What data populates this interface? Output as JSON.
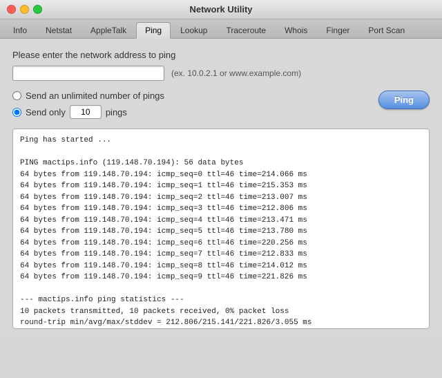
{
  "titlebar": {
    "title": "Network Utility"
  },
  "tabs": [
    {
      "label": "Info",
      "id": "info",
      "active": false
    },
    {
      "label": "Netstat",
      "id": "netstat",
      "active": false
    },
    {
      "label": "AppleTalk",
      "id": "appletalk",
      "active": false
    },
    {
      "label": "Ping",
      "id": "ping",
      "active": true
    },
    {
      "label": "Lookup",
      "id": "lookup",
      "active": false
    },
    {
      "label": "Traceroute",
      "id": "traceroute",
      "active": false
    },
    {
      "label": "Whois",
      "id": "whois",
      "active": false
    },
    {
      "label": "Finger",
      "id": "finger",
      "active": false
    },
    {
      "label": "Port Scan",
      "id": "portscan",
      "active": false
    }
  ],
  "ping": {
    "prompt": "Please enter the network address to ping",
    "address_placeholder": "",
    "address_hint": "(ex. 10.0.2.1 or www.example.com)",
    "radio_unlimited_label": "Send an unlimited number of pings",
    "radio_sendonly_label": "Send only",
    "pings_value": "10",
    "pings_suffix": "pings",
    "ping_button_label": "Ping",
    "output": "Ping has started ...\n\nPING mactips.info (119.148.70.194): 56 data bytes\n64 bytes from 119.148.70.194: icmp_seq=0 ttl=46 time=214.066 ms\n64 bytes from 119.148.70.194: icmp_seq=1 ttl=46 time=215.353 ms\n64 bytes from 119.148.70.194: icmp_seq=2 ttl=46 time=213.007 ms\n64 bytes from 119.148.70.194: icmp_seq=3 ttl=46 time=212.806 ms\n64 bytes from 119.148.70.194: icmp_seq=4 ttl=46 time=213.471 ms\n64 bytes from 119.148.70.194: icmp_seq=5 ttl=46 time=213.780 ms\n64 bytes from 119.148.70.194: icmp_seq=6 ttl=46 time=220.256 ms\n64 bytes from 119.148.70.194: icmp_seq=7 ttl=46 time=212.833 ms\n64 bytes from 119.148.70.194: icmp_seq=8 ttl=46 time=214.012 ms\n64 bytes from 119.148.70.194: icmp_seq=9 ttl=46 time=221.826 ms\n\n--- mactips.info ping statistics ---\n10 packets transmitted, 10 packets received, 0% packet loss\nround-trip min/avg/max/stddev = 212.806/215.141/221.826/3.055 ms"
  }
}
